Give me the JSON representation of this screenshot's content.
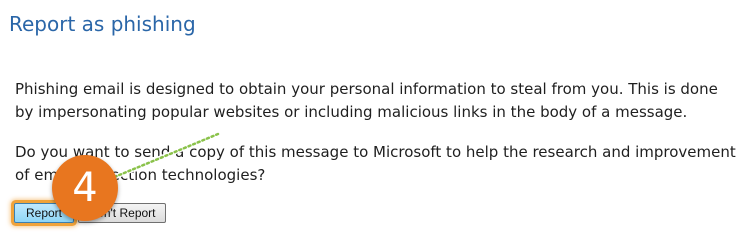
{
  "dialog": {
    "title": "Report as phishing",
    "description": "Phishing email is designed to obtain your personal information to steal from you. This is done by impersonating popular websites or including malicious links in the body of a message.",
    "question": "Do you want to send a copy of this message to Microsoft to help the research and improvement of email protection technologies?"
  },
  "buttons": {
    "report_label": "Report",
    "dont_report_label": "Don't Report"
  },
  "annotation": {
    "step_number": "4",
    "badge_color": "#e8761f",
    "highlight_color": "#f0a33a"
  },
  "colors": {
    "title": "#2a66a8"
  }
}
